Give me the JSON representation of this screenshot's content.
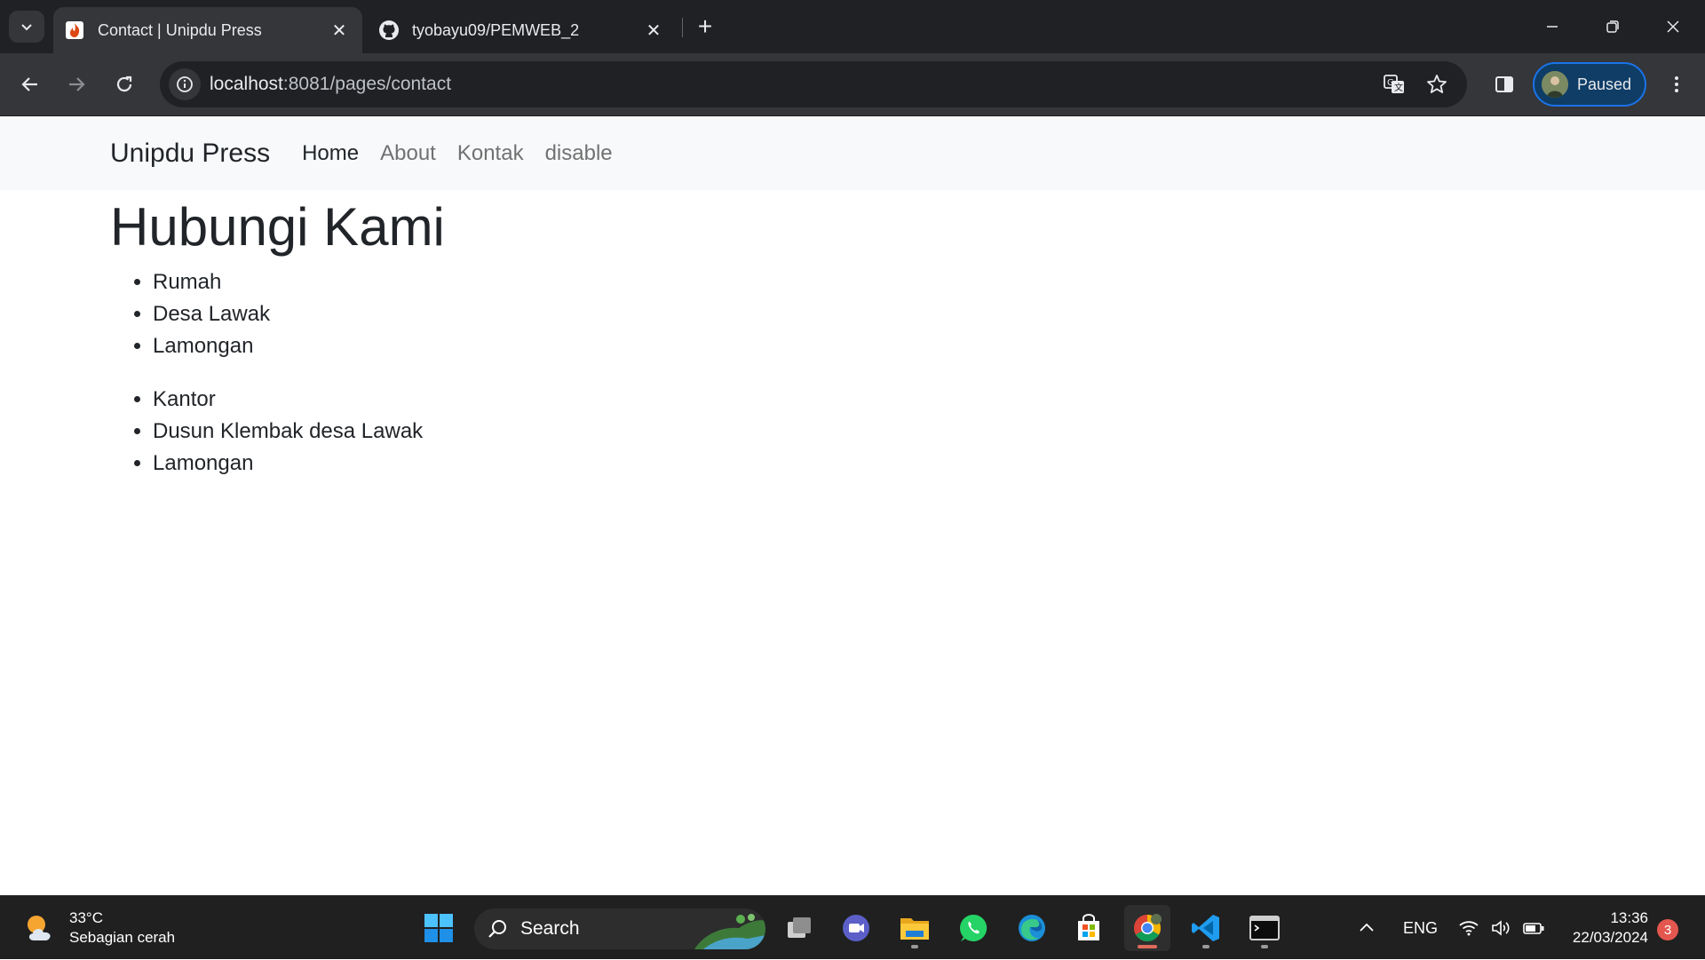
{
  "browser": {
    "tabs": [
      {
        "title": "Contact | Unipdu Press",
        "active": true,
        "icon": "codeigniter-flame-icon"
      },
      {
        "title": "tyobayu09/PEMWEB_2",
        "active": false,
        "icon": "github-icon"
      }
    ],
    "url_host": "localhost",
    "url_path": ":8081/pages/contact",
    "profile_label": "Paused"
  },
  "page": {
    "brand": "Unipdu Press",
    "nav": [
      {
        "label": "Home",
        "active": true
      },
      {
        "label": "About",
        "active": false
      },
      {
        "label": "Kontak",
        "active": false
      },
      {
        "label": "disable",
        "active": false
      }
    ],
    "heading": "Hubungi Kami",
    "addresses": [
      [
        "Rumah",
        "Desa Lawak",
        "Lamongan"
      ],
      [
        "Kantor",
        "Dusun Klembak desa Lawak",
        "Lamongan"
      ]
    ]
  },
  "taskbar": {
    "weather_temp": "33°C",
    "weather_desc": "Sebagian cerah",
    "search_label": "Search",
    "language": "ENG",
    "time": "13:36",
    "date": "22/03/2024",
    "notification_count": "3"
  },
  "colors": {
    "chrome_dark": "#202124",
    "chrome_toolbar": "#35363a",
    "navbar_bg": "#f8f9fa",
    "text_dark": "#212529",
    "profile_chip": "#0f3d66"
  }
}
